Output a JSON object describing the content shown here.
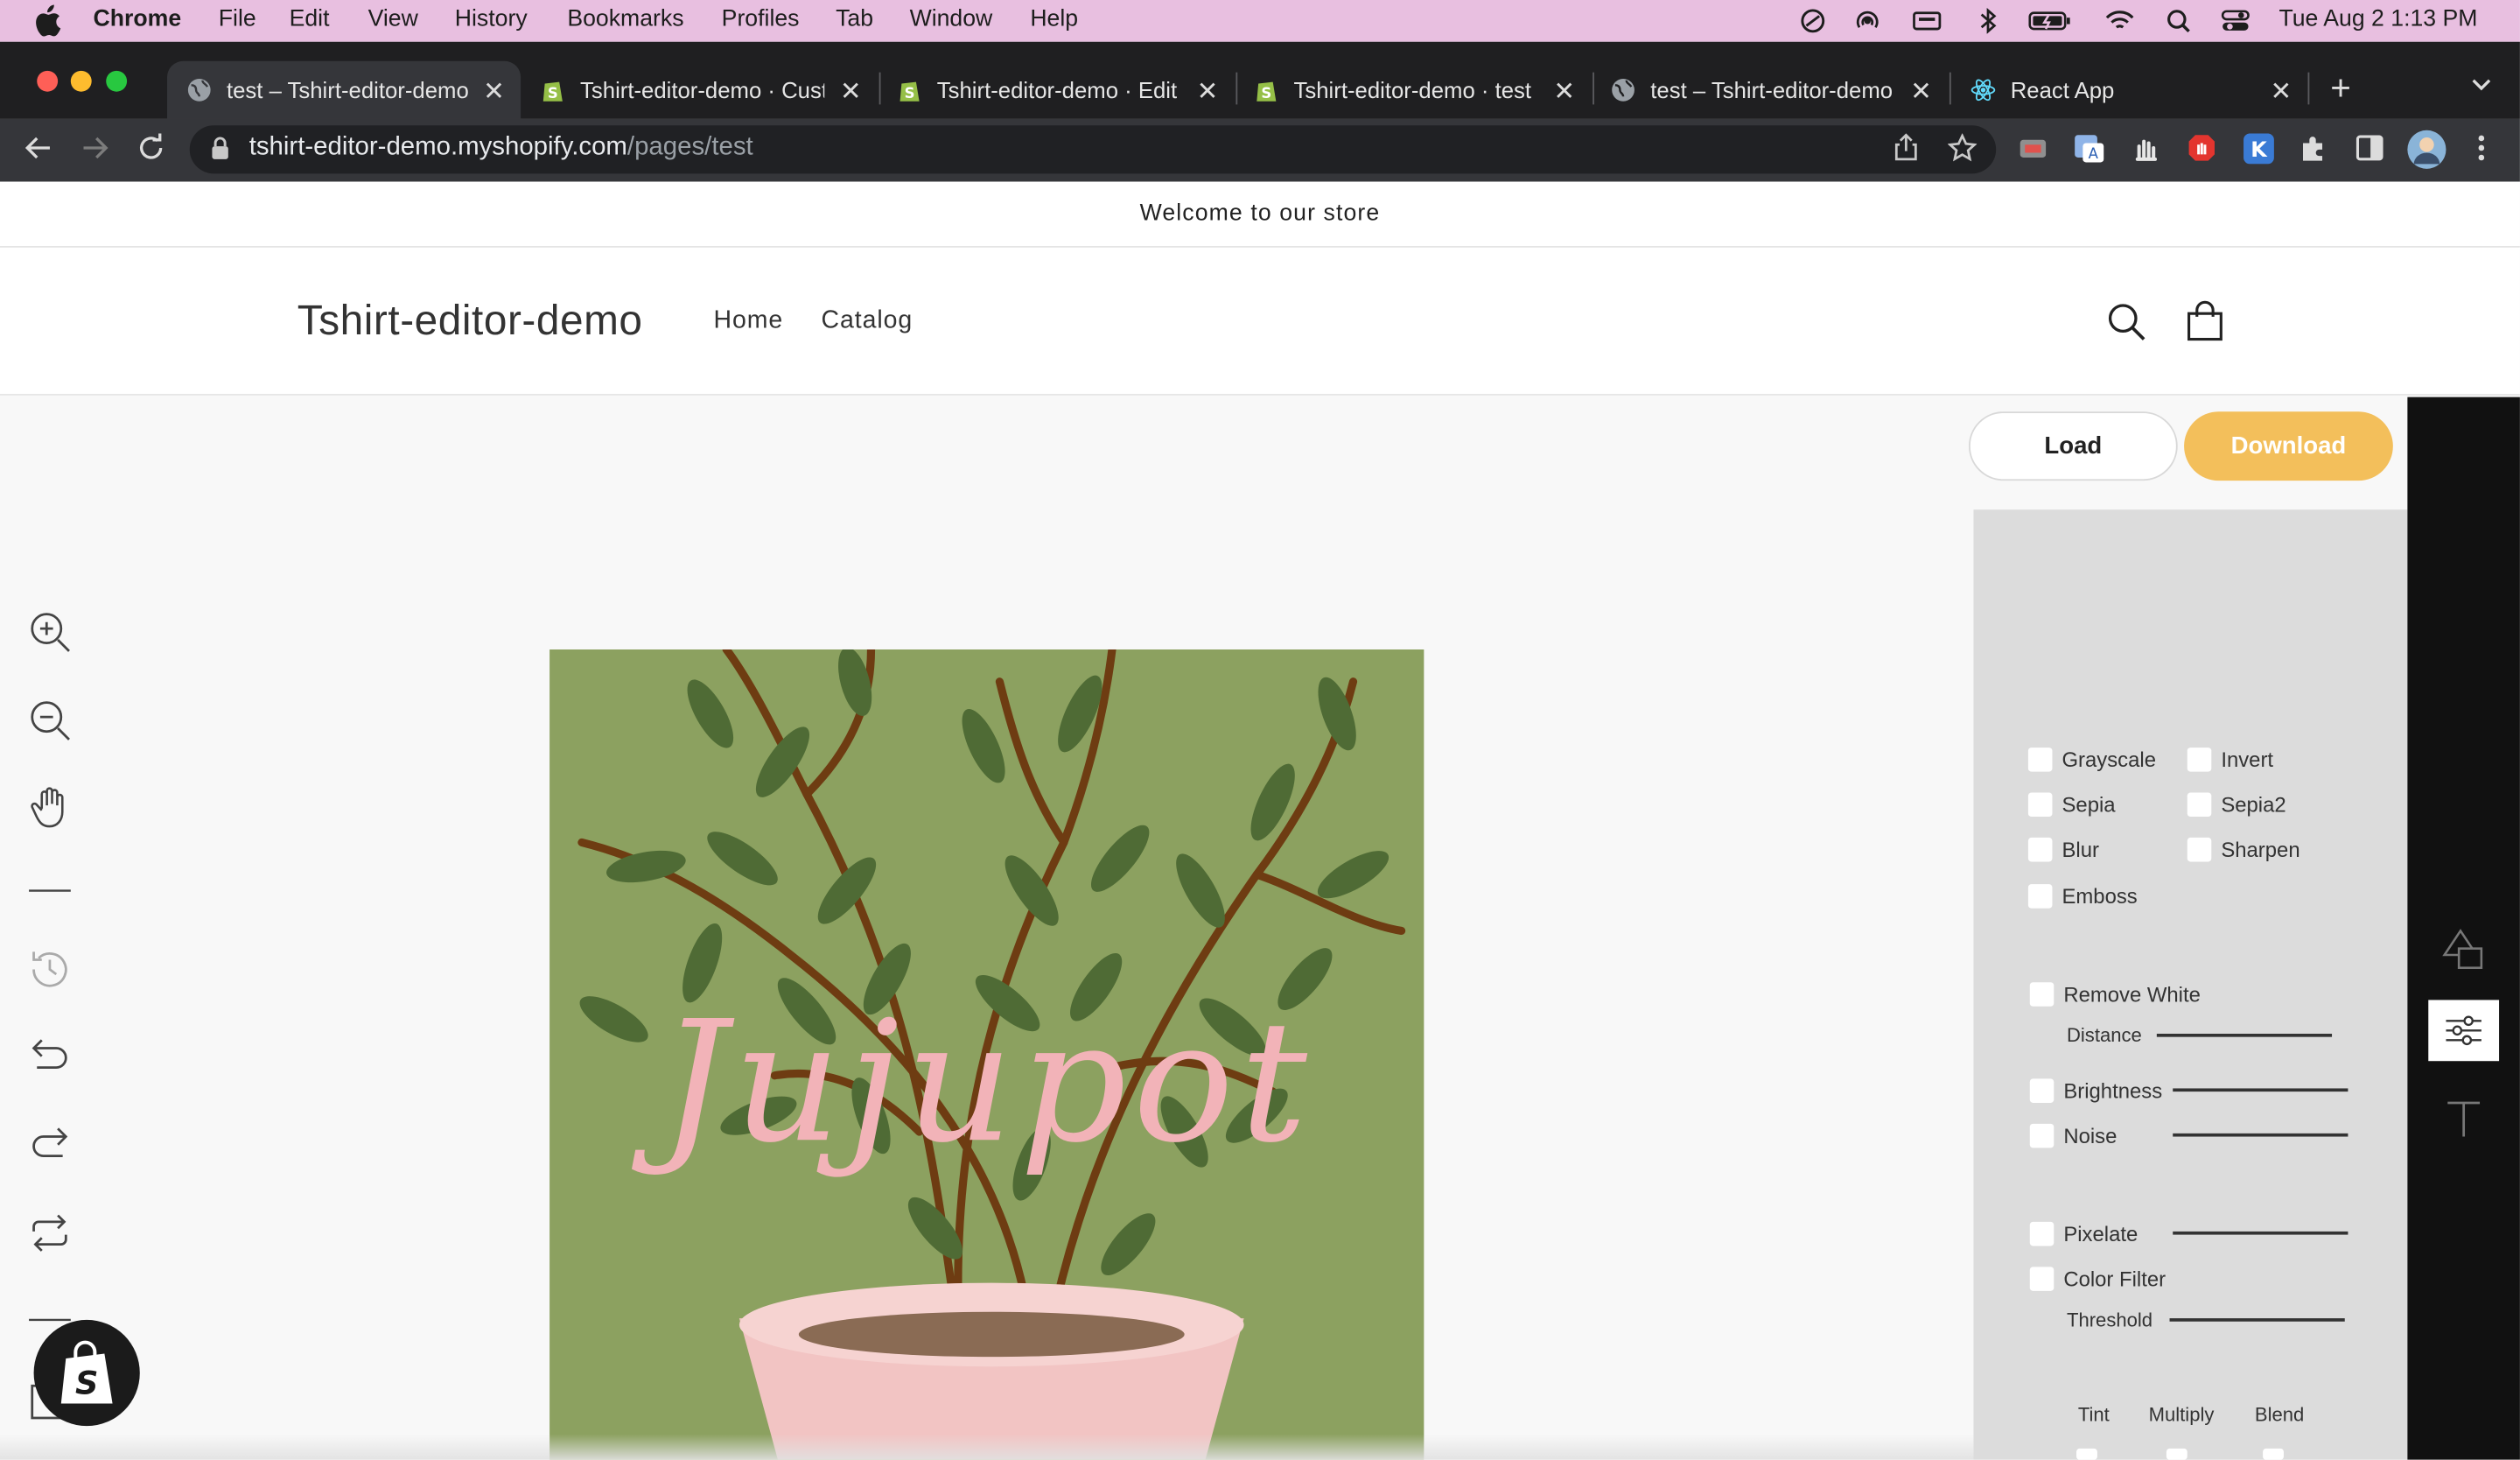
{
  "menubar": {
    "app_name": "Chrome",
    "items": [
      "File",
      "Edit",
      "View",
      "History",
      "Bookmarks",
      "Profiles",
      "Tab",
      "Window",
      "Help"
    ],
    "clock": "Tue Aug 2  1:13 PM"
  },
  "tabs": [
    {
      "title": "test – Tshirt-editor-demo",
      "icon": "globe-icon",
      "active": true
    },
    {
      "title": "Tshirt-editor-demo · Customize",
      "icon": "shopify-icon",
      "active": false
    },
    {
      "title": "Tshirt-editor-demo · Edit",
      "icon": "shopify-icon",
      "active": false
    },
    {
      "title": "Tshirt-editor-demo · test",
      "icon": "shopify-icon",
      "active": false
    },
    {
      "title": "test – Tshirt-editor-demo",
      "icon": "globe-icon",
      "active": false
    },
    {
      "title": "React App",
      "icon": "react-icon",
      "active": false
    }
  ],
  "address_bar": {
    "host": "tshirt-editor-demo.myshopify.com",
    "path": "/pages/test"
  },
  "store": {
    "announcement": "Welcome to our store",
    "logo": "Tshirt-editor-demo",
    "nav": [
      "Home",
      "Catalog"
    ]
  },
  "editor": {
    "load_label": "Load",
    "download_label": "Download",
    "image_text": "Jujupot",
    "filters": {
      "grayscale": "Grayscale",
      "invert": "Invert",
      "sepia": "Sepia",
      "sepia2": "Sepia2",
      "blur": "Blur",
      "sharpen": "Sharpen",
      "emboss": "Emboss",
      "remove_white": "Remove White",
      "distance": "Distance",
      "brightness": "Brightness",
      "noise": "Noise",
      "pixelate": "Pixelate",
      "color_filter": "Color Filter",
      "threshold": "Threshold",
      "tint": "Tint",
      "multiply": "Multiply",
      "blend": "Blend"
    }
  },
  "colors": {
    "menubar": "#e8bfe0",
    "download_button": "#f3bf5b",
    "image_background": "#8ca160",
    "image_text": "#f2b3b8"
  }
}
